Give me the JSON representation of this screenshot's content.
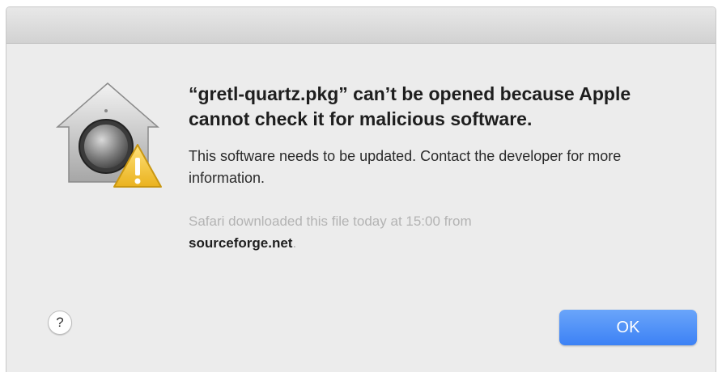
{
  "dialog": {
    "icon": "gatekeeper-warning-icon",
    "title": "“gretl-quartz.pkg” can’t be opened because Apple cannot check it for malicious software.",
    "message": "This software needs to be updated. Contact the developer for more information.",
    "source_prefix": "Safari downloaded this file today at 15:00 from",
    "source_host": "sourceforge.net",
    "source_suffix": ".",
    "help_label": "?",
    "ok_label": "OK"
  },
  "colors": {
    "accent": "#3c81f5",
    "background": "#ececec",
    "warning": "#f3c53a"
  }
}
